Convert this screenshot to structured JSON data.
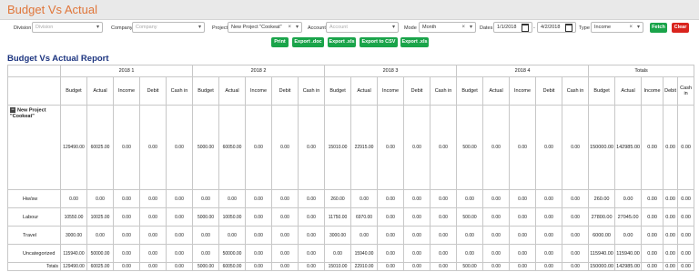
{
  "app": {
    "title": "Budget Vs Actual"
  },
  "filters": {
    "division": {
      "label": "Division",
      "placeholder": "Division"
    },
    "company": {
      "label": "Company",
      "placeholder": "Company"
    },
    "project": {
      "label": "Project",
      "value": "New Project \"Cookeat\""
    },
    "account": {
      "label": "Account",
      "placeholder": "Account"
    },
    "mode": {
      "label": "Mode",
      "value": "Month"
    },
    "dates": {
      "label": "Dates",
      "from": "1/1/2018",
      "sep": "-",
      "to": "4/2/2018"
    },
    "type": {
      "label": "Type",
      "value": "Income"
    },
    "fetch_label": "Fetch",
    "clear_label": "Clear"
  },
  "actions": {
    "print": "Print",
    "doc": "Export .doc",
    "xls": "Export .xls",
    "csv": "Export to CSV",
    "xls2": "Export .xls"
  },
  "report": {
    "title": "Budget Vs Actual Report",
    "groups": [
      "2018 1",
      "2018 2",
      "2018 3",
      "2018 4",
      "Totals"
    ],
    "columns": [
      "Budget",
      "Actual",
      "Income",
      "Debit",
      "Cash in"
    ],
    "rows": [
      {
        "label": "New Project \"Cookeat\"",
        "values": [
          "129490.00",
          "60025.00",
          "0.00",
          "0.00",
          "0.00",
          "5000.00",
          "60050.00",
          "0.00",
          "0.00",
          "0.00",
          "15010.00",
          "22915.00",
          "0.00",
          "0.00",
          "0.00",
          "500.00",
          "0.00",
          "0.00",
          "0.00",
          "0.00",
          "150000.00",
          "142985.00",
          "0.00",
          "0.00",
          "0.00"
        ]
      },
      {
        "label": "Hw/sw",
        "values": [
          "0.00",
          "0.00",
          "0.00",
          "0.00",
          "0.00",
          "0.00",
          "0.00",
          "0.00",
          "0.00",
          "0.00",
          "260.00",
          "0.00",
          "0.00",
          "0.00",
          "0.00",
          "0.00",
          "0.00",
          "0.00",
          "0.00",
          "0.00",
          "260.00",
          "0.00",
          "0.00",
          "0.00",
          "0.00"
        ]
      },
      {
        "label": "Labour",
        "values": [
          "10550.00",
          "10025.00",
          "0.00",
          "0.00",
          "0.00",
          "5000.00",
          "10050.00",
          "0.00",
          "0.00",
          "0.00",
          "11750.00",
          "6970.00",
          "0.00",
          "0.00",
          "0.00",
          "500.00",
          "0.00",
          "0.00",
          "0.00",
          "0.00",
          "27800.00",
          "27045.00",
          "0.00",
          "0.00",
          "0.00"
        ]
      },
      {
        "label": "Travel",
        "values": [
          "3000.00",
          "0.00",
          "0.00",
          "0.00",
          "0.00",
          "0.00",
          "0.00",
          "0.00",
          "0.00",
          "0.00",
          "3000.00",
          "0.00",
          "0.00",
          "0.00",
          "0.00",
          "0.00",
          "0.00",
          "0.00",
          "0.00",
          "0.00",
          "6000.00",
          "0.00",
          "0.00",
          "0.00",
          "0.00"
        ]
      },
      {
        "label": "Uncategorized",
        "values": [
          "115940.00",
          "50000.00",
          "0.00",
          "0.00",
          "0.00",
          "0.00",
          "50000.00",
          "0.00",
          "0.00",
          "0.00",
          "0.00",
          "15940.00",
          "0.00",
          "0.00",
          "0.00",
          "0.00",
          "0.00",
          "0.00",
          "0.00",
          "0.00",
          "115940.00",
          "115940.00",
          "0.00",
          "0.00",
          "0.00"
        ]
      }
    ],
    "totals": {
      "label": "Totals",
      "values": [
        "129490.00",
        "60025.00",
        "0.00",
        "0.00",
        "0.00",
        "5000.00",
        "60050.00",
        "0.00",
        "0.00",
        "0.00",
        "15010.00",
        "22910.00",
        "0.00",
        "0.00",
        "0.00",
        "500.00",
        "0.00",
        "0.00",
        "0.00",
        "0.00",
        "150000.00",
        "142985.00",
        "0.00",
        "0.00",
        "0.00"
      ]
    }
  }
}
